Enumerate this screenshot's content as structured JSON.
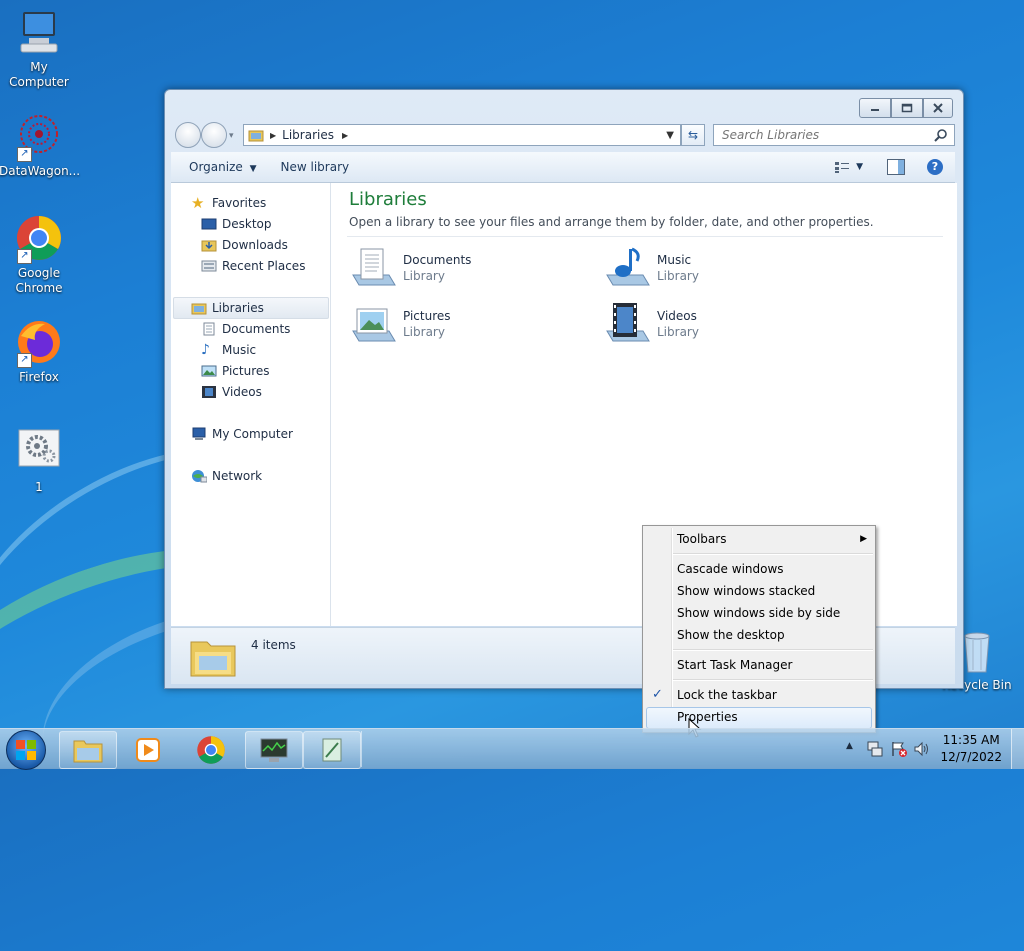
{
  "desktop": {
    "icons": [
      {
        "label": "My Computer"
      },
      {
        "label": "DataWagon..."
      },
      {
        "label": "Google Chrome"
      },
      {
        "label": "Firefox"
      },
      {
        "label": "1"
      },
      {
        "label": "Recycle Bin"
      }
    ]
  },
  "explorer": {
    "address": {
      "crumb": "Libraries"
    },
    "search": {
      "placeholder": "Search Libraries"
    },
    "toolbar": {
      "organize": "Organize",
      "new_library": "New library"
    },
    "nav": {
      "favorites": "Favorites",
      "desktop": "Desktop",
      "downloads": "Downloads",
      "recent_places": "Recent Places",
      "libraries": "Libraries",
      "documents": "Documents",
      "music": "Music",
      "pictures": "Pictures",
      "videos": "Videos",
      "my_computer": "My Computer",
      "network": "Network"
    },
    "main": {
      "title": "Libraries",
      "subtitle": "Open a library to see your files and arrange them by folder, date, and other properties.",
      "items": [
        {
          "name": "Documents",
          "type": "Library"
        },
        {
          "name": "Music",
          "type": "Library"
        },
        {
          "name": "Pictures",
          "type": "Library"
        },
        {
          "name": "Videos",
          "type": "Library"
        }
      ]
    },
    "status": {
      "count": "4 items"
    }
  },
  "context_menu": {
    "toolbars": "Toolbars",
    "cascade": "Cascade windows",
    "stacked": "Show windows stacked",
    "side_by_side": "Show windows side by side",
    "show_desktop": "Show the desktop",
    "task_manager": "Start Task Manager",
    "lock_taskbar": "Lock the taskbar",
    "properties": "Properties",
    "lock_checked": true
  },
  "taskbar": {
    "clock_time": "11:35 AM",
    "clock_date": "12/7/2022"
  }
}
